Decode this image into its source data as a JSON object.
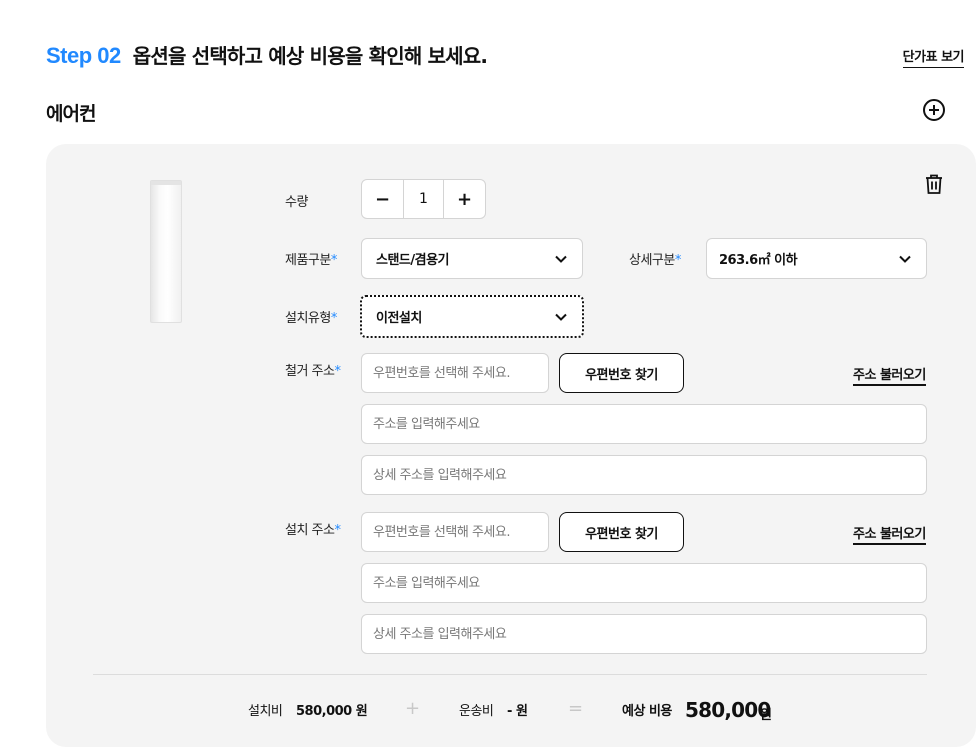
{
  "header": {
    "step_label": "Step 02",
    "title": "옵션을 선택하고 예상 비용을 확인해 보세요.",
    "price_table_link": "단가표 보기"
  },
  "section": {
    "title": "에어컨",
    "add_icon": "plus-circle-icon"
  },
  "form": {
    "quantity": {
      "label": "수량",
      "value": "1",
      "minus": "−",
      "plus": "+"
    },
    "product_type": {
      "label": "제품구분",
      "value": "스탠드/겸용기"
    },
    "detail_type": {
      "label": "상세구분",
      "value": "263.6㎡ 이하"
    },
    "install_type": {
      "label": "설치유형",
      "value": "이전설치"
    },
    "removal_address": {
      "label": "철거 주소",
      "zip_placeholder": "우편번호를 선택해 주세요.",
      "find_zip_button": "우편번호 찾기",
      "load_address_link": "주소 불러오기",
      "address_placeholder": "주소를 입력해주세요",
      "detail_placeholder": "상세 주소를 입력해주세요"
    },
    "install_address": {
      "label": "설치 주소",
      "zip_placeholder": "우편번호를 선택해 주세요.",
      "find_zip_button": "우편번호 찾기",
      "load_address_link": "주소 불러오기",
      "address_placeholder": "주소를 입력해주세요",
      "detail_placeholder": "상세 주소를 입력해주세요"
    },
    "required_mark": "*"
  },
  "summary": {
    "install_fee_label": "설치비",
    "install_fee_value": "580,000",
    "currency": "원",
    "plus": "+",
    "shipping_label": "운송비",
    "shipping_value": "-",
    "equals": "=",
    "estimate_label": "예상 비용",
    "estimate_value": "580,000"
  },
  "colors": {
    "accent": "#2189ff",
    "card_bg": "#f4f4f4",
    "border": "#d4d4d4"
  }
}
